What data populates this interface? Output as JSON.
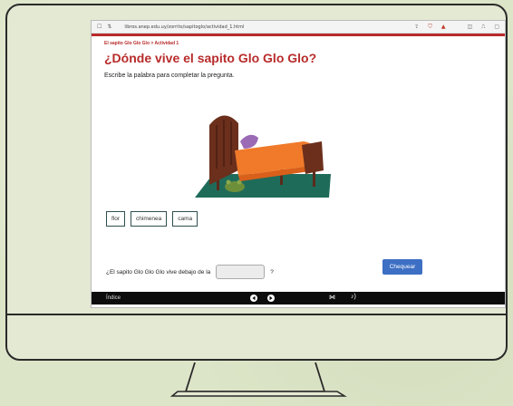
{
  "browser": {
    "url": "libros.anep.edu.uy/zorrito/sapitoglo/actividad_1.html"
  },
  "page": {
    "breadcrumb": "El sapito Glo Glo Glo > Actividad 1",
    "title": "¿Dónde vive el sapito Glo Glo Glo?",
    "instruction": "Escribe la palabra para completar la pregunta."
  },
  "word_bank": [
    "flor",
    "chimenea",
    "cama"
  ],
  "question": {
    "text": "¿El sapito Glo Glo Glo vive debajo de la",
    "suffix": "?",
    "answer_value": ""
  },
  "check_button": {
    "label": "Chequear"
  },
  "player": {
    "index_label": "Índice",
    "icons": [
      "previous-icon",
      "next-icon",
      "fullscreen-icon",
      "audio-icon"
    ]
  },
  "colors": {
    "accent": "#b82b2b",
    "button": "#3d6fc4",
    "background": "#dde5c8"
  }
}
